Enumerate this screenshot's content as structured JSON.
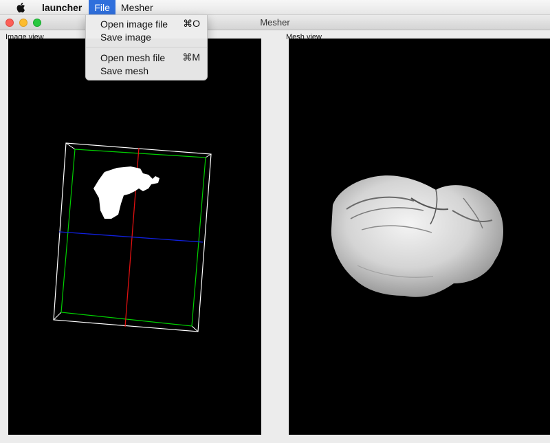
{
  "menubar": {
    "app_name": "launcher",
    "menus": [
      {
        "label": "File"
      },
      {
        "label": "Mesher"
      }
    ]
  },
  "window": {
    "title": "Mesher"
  },
  "panels": {
    "image_view_label": "Image view",
    "mesh_view_label": "Mesh view"
  },
  "file_menu": {
    "items": [
      {
        "label": "Open image file",
        "shortcut": "⌘O"
      },
      {
        "label": "Save image",
        "shortcut": ""
      },
      {
        "label": "Open mesh file",
        "shortcut": "⌘M"
      },
      {
        "label": "Save mesh",
        "shortcut": ""
      }
    ]
  },
  "colors": {
    "menu_highlight": "#2f6fdc",
    "bounding_box": "#ffffff",
    "inner_box": "#00d000",
    "axis_vertical": "#e01010",
    "axis_horizontal": "#1020e0",
    "mesh": "#e6e6e6"
  }
}
